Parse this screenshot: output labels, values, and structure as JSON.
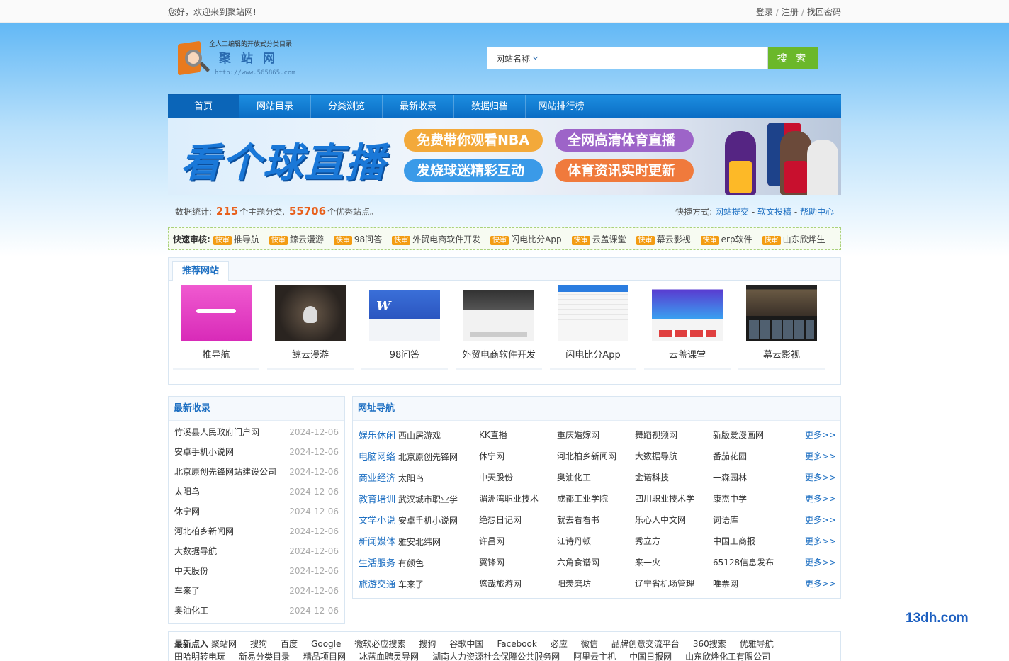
{
  "topbar": {
    "welcome": "您好，欢迎来到聚站网!",
    "login": "登录",
    "register": "注册",
    "recover": "找回密码",
    "sep": "/"
  },
  "logo": {
    "slogan": "全人工编辑的开放式分类目录",
    "name": "聚站网",
    "url": "http://www.565865.com"
  },
  "search": {
    "type": "网站名称",
    "placeholder": "",
    "button": "搜 索"
  },
  "nav": [
    "首页",
    "网站目录",
    "分类浏览",
    "最新收录",
    "数据归档",
    "网站排行榜"
  ],
  "banner": {
    "headline": "看个球直播",
    "pills": [
      "免费带你观看NBA",
      "全网高清体育直播",
      "发烧球迷精彩互动",
      "体育资讯实时更新"
    ]
  },
  "stats": {
    "prefix": "数据统计:",
    "categories": "215",
    "cat_suffix": "个主题分类,",
    "sites": "55706",
    "site_suffix": "个优秀站点。",
    "quick_label": "快捷方式:",
    "links": [
      "网站提交",
      "软文投稿",
      "帮助中心"
    ],
    "link_sep": " - "
  },
  "quick_audit": {
    "label": "快速审核:",
    "tag": "快审",
    "items": [
      "推导航",
      "鲸云漫游",
      "98问答",
      "外贸电商软件开发",
      "闪电比分App",
      "云盖课堂",
      "幕云影视",
      "erp软件",
      "山东欣烨生"
    ]
  },
  "recommended": {
    "tab": "推荐网站",
    "items": [
      "推导航",
      "鲸云漫游",
      "98问答",
      "外贸电商软件开发",
      "闪电比分App",
      "云盖课堂",
      "幕云影视"
    ]
  },
  "latest": {
    "title": "最新收录",
    "items": [
      {
        "name": "竹溪县人民政府门户网",
        "date": "2024-12-06"
      },
      {
        "name": "安卓手机小说网",
        "date": "2024-12-06"
      },
      {
        "name": "北京原创先锋网站建设公司",
        "date": "2024-12-06"
      },
      {
        "name": "太阳鸟",
        "date": "2024-12-06"
      },
      {
        "name": "休宁网",
        "date": "2024-12-06"
      },
      {
        "name": "河北柏乡新闻网",
        "date": "2024-12-06"
      },
      {
        "name": "大数据导航",
        "date": "2024-12-06"
      },
      {
        "name": "中天股份",
        "date": "2024-12-06"
      },
      {
        "name": "车来了",
        "date": "2024-12-06"
      },
      {
        "name": "奥油化工",
        "date": "2024-12-06"
      }
    ]
  },
  "directory": {
    "title": "网址导航",
    "more": "更多>>",
    "rows": [
      {
        "cat": "娱乐休闲",
        "sites": [
          "西山居游戏",
          "KK直播",
          "重庆婚嫁网",
          "舞蹈视频网",
          "新版爱漫画网"
        ]
      },
      {
        "cat": "电脑网络",
        "sites": [
          "北京原创先锋网",
          "休宁网",
          "河北柏乡新闻网",
          "大数据导航",
          "番茄花园"
        ]
      },
      {
        "cat": "商业经济",
        "sites": [
          "太阳鸟",
          "中天股份",
          "奥油化工",
          "金诺科技",
          "一森园林"
        ]
      },
      {
        "cat": "教育培训",
        "sites": [
          "武汉城市职业学",
          "湄洲湾职业技术",
          "成都工业学院",
          "四川职业技术学",
          "康杰中学"
        ]
      },
      {
        "cat": "文学小说",
        "sites": [
          "安卓手机小说网",
          "绝想日记网",
          "就去看看书",
          "乐心人中文网",
          "词语库"
        ]
      },
      {
        "cat": "新闻媒体",
        "sites": [
          "雅安北纬网",
          "许昌网",
          "江诗丹顿",
          "秀立方",
          "中国工商报"
        ]
      },
      {
        "cat": "生活服务",
        "sites": [
          "有颜色",
          "翼锋网",
          "六角食谱网",
          "来一火",
          "65128信息发布"
        ]
      },
      {
        "cat": "旅游交通",
        "sites": [
          "车来了",
          "悠哉旅游网",
          "阳羡磨坊",
          "辽宁省机场管理",
          "唯票网"
        ]
      }
    ]
  },
  "latest_clicks": {
    "label": "最新点入",
    "line1": [
      "聚站网",
      "搜狗",
      "百度",
      "Google",
      "微软必应搜索",
      "搜狗",
      "谷歌中国",
      "Facebook",
      "必应",
      "微信",
      "品牌创意交流平台",
      "360搜索",
      "优雅导航"
    ],
    "line2": [
      "田哈明转电玩",
      "新易分类目录",
      "精品项目网",
      "冰蓝血聘灵导网",
      "湖南人力资源社会保障公共服务网",
      "阿里云主机",
      "中国日报网",
      "山东欣烨化工有限公司"
    ]
  },
  "watermark": "13dh.com"
}
